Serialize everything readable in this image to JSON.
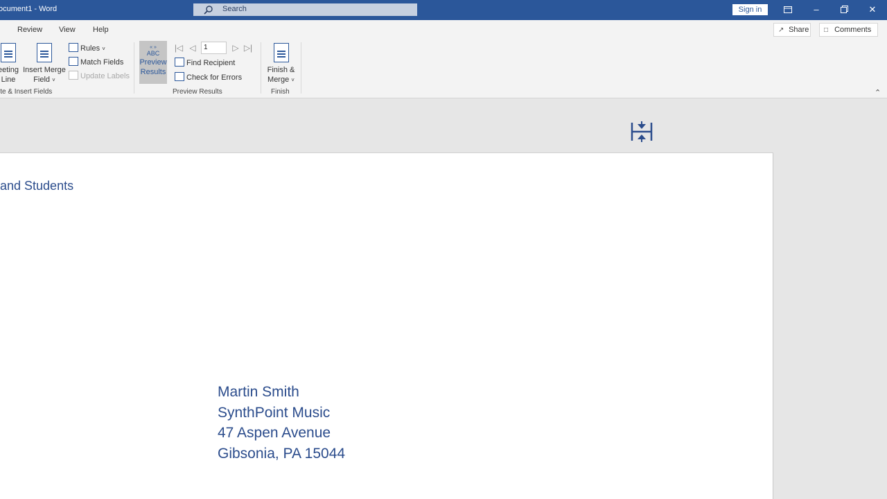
{
  "titlebar": {
    "doc_title": "ocument1  -  Word",
    "search_label": "Search",
    "signin_label": "Sign in",
    "window_buttons": [
      "restore-ribbon-icon",
      "minimize-icon",
      "maximize-icon",
      "close-icon"
    ]
  },
  "ribbon": {
    "tabs": [
      "Review",
      "View",
      "Help"
    ],
    "share_label": "Share",
    "comments_label": "Comments",
    "write_insert": {
      "greeting_line_1": "eeting",
      "greeting_line_2": "Line",
      "insert_merge_1": "Insert Merge",
      "insert_merge_2": "Field",
      "rules": "Rules",
      "match_fields": "Match Fields",
      "update_labels": "Update Labels",
      "group_label": "ite & Insert Fields"
    },
    "preview": {
      "abc": "«  »\nABC",
      "preview_1": "Preview",
      "preview_2": "Results",
      "record_value": "1",
      "find_recipient": "Find Recipient",
      "check_errors": "Check for Errors",
      "group_label": "Preview Results"
    },
    "finish": {
      "finish_1": "Finish &",
      "finish_2": "Merge",
      "group_label": "Finish"
    }
  },
  "document": {
    "return_address_fragment": "and Students",
    "recipient_lines": [
      "Martin Smith",
      "SynthPoint Music",
      "47 Aspen Avenue",
      "Gibsonia, PA 15044"
    ]
  },
  "colors": {
    "accent": "#2b579a",
    "text_blue": "#2b4c8c"
  }
}
